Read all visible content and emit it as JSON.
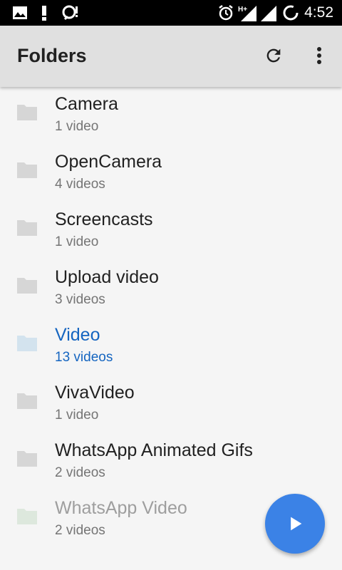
{
  "status_bar": {
    "time": "4:52",
    "network_label": "H+",
    "icons": [
      "image-icon",
      "alert-icon",
      "notification-icon",
      "alarm-icon",
      "signal-icon",
      "signal-icon",
      "loading-icon"
    ]
  },
  "app_bar": {
    "title": "Folders",
    "actions": [
      "refresh-icon",
      "more-vert-icon"
    ]
  },
  "folders": [
    {
      "name": "Camera",
      "count": "1 video"
    },
    {
      "name": "OpenCamera",
      "count": "4 videos"
    },
    {
      "name": "Screencasts",
      "count": "1 video"
    },
    {
      "name": "Upload video",
      "count": "3 videos"
    },
    {
      "name": "Video",
      "count": "13 videos"
    },
    {
      "name": "VivaVideo",
      "count": "1 video"
    },
    {
      "name": "WhatsApp Animated Gifs",
      "count": "2 videos"
    },
    {
      "name": "WhatsApp Video",
      "count": "2 videos"
    }
  ],
  "fab": {
    "icon": "play-icon"
  },
  "colors": {
    "accent": "#1565c0",
    "fab": "#3b82e6",
    "app_bar": "#e0e0e0",
    "background": "#f5f5f5"
  }
}
